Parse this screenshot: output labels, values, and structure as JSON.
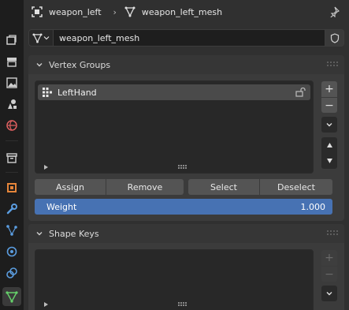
{
  "tabs": [
    {
      "name": "tab-tool",
      "icon": "tool-icon"
    },
    {
      "name": "tab-render",
      "icon": "render-icon"
    },
    {
      "name": "tab-output",
      "icon": "output-icon"
    },
    {
      "name": "tab-view-layer",
      "icon": "view-layer-icon"
    },
    {
      "name": "tab-scene",
      "icon": "scene-icon"
    },
    {
      "name": "tab-world",
      "icon": "world-icon"
    },
    {
      "name": "tab-collection",
      "icon": "collection-icon"
    },
    {
      "name": "tab-object",
      "icon": "object-icon"
    },
    {
      "name": "tab-modifiers",
      "icon": "wrench-icon"
    },
    {
      "name": "tab-particles",
      "icon": "particles-icon"
    },
    {
      "name": "tab-physics",
      "icon": "physics-icon"
    },
    {
      "name": "tab-constraints",
      "icon": "constraints-icon"
    },
    {
      "name": "tab-data",
      "icon": "mesh-data-icon",
      "active": true
    }
  ],
  "breadcrumb": {
    "object_name": "weapon_left",
    "separator": "›",
    "mesh_name": "weapon_left_mesh"
  },
  "datablock": {
    "name": "weapon_left_mesh"
  },
  "vertex_groups": {
    "title": "Vertex Groups",
    "items": [
      {
        "label": "LeftHand",
        "locked": false
      }
    ],
    "buttons": {
      "assign": "Assign",
      "remove": "Remove",
      "select": "Select",
      "deselect": "Deselect"
    },
    "weight": {
      "label": "Weight",
      "value": "1.000"
    }
  },
  "shape_keys": {
    "title": "Shape Keys",
    "items": []
  },
  "colors": {
    "accent": "#4772b3",
    "panel": "#3b3b3b",
    "list": "#282828",
    "mesh_green": "#65d06a",
    "object_orange": "#e5853a"
  }
}
